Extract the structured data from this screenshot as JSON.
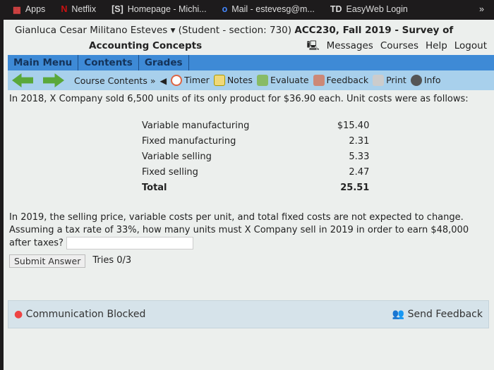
{
  "bookmarks": [
    {
      "label": "Apps",
      "icon": "apps-grid-icon"
    },
    {
      "label": "Netflix",
      "icon": "netflix-icon"
    },
    {
      "label": "Homepage - Michi...",
      "icon": "s-logo-icon"
    },
    {
      "label": "Mail - estevesg@m...",
      "icon": "outlook-icon"
    },
    {
      "label": "EasyWeb Login",
      "icon": "td-icon"
    }
  ],
  "bookmarks_more": "»",
  "header": {
    "user": "Gianluca Cesar Militano Esteves ▾",
    "role": "(Student  - section: 730)",
    "course_line1": "ACC230, Fall 2019 - Survey of",
    "course_line2": "Accounting Concepts",
    "links": [
      "Messages",
      "Courses",
      "Help",
      "Logout"
    ]
  },
  "menu": [
    "Main Menu",
    "Contents",
    "Grades"
  ],
  "toolbar": {
    "course_contents": "Course Contents »",
    "timer": "Timer",
    "notes": "Notes",
    "evaluate": "Evaluate",
    "feedback": "Feedback",
    "print": "Print",
    "info": "Info"
  },
  "question": {
    "intro": "In 2018, X Company sold 6,500 units of its only product for $36.90 each. Unit costs were as follows:",
    "costs": [
      {
        "label": "Variable manufacturing",
        "value": "$15.40"
      },
      {
        "label": "Fixed manufacturing",
        "value": "2.31"
      },
      {
        "label": "Variable selling",
        "value": "5.33"
      },
      {
        "label": "Fixed selling",
        "value": "2.47"
      }
    ],
    "total": {
      "label": "Total",
      "value": "25.51"
    },
    "prompt": "In 2019, the selling price, variable costs per unit, and total fixed costs are not expected to change. Assuming a tax rate of 33%, how many units must X Company sell in 2019 in order to earn $48,000 after taxes?",
    "answer": "",
    "submit": "Submit Answer",
    "tries": "Tries 0/3"
  },
  "footer": {
    "status": "Communication Blocked",
    "send_feedback": "Send Feedback"
  }
}
